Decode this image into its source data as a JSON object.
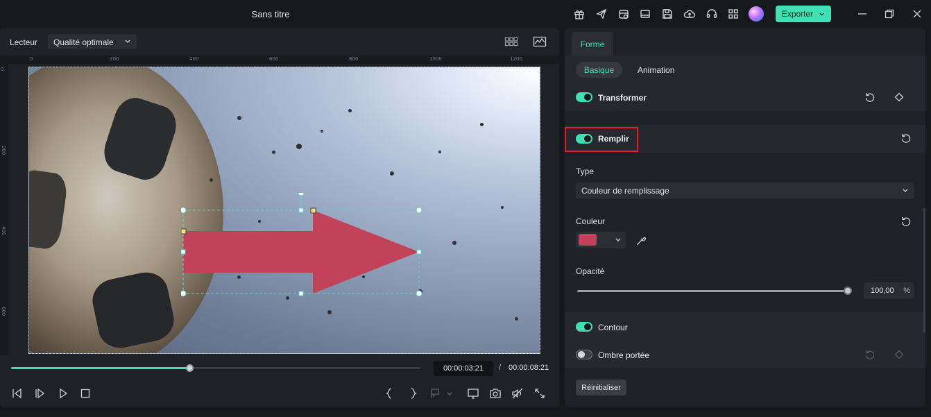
{
  "app": {
    "title": "Sans titre",
    "export_label": "Exporter",
    "accent_color": "#40e0b5"
  },
  "titlebar_icons": [
    "gift-icon",
    "send-icon",
    "calendar-icon",
    "layout-icon",
    "save-icon",
    "cloud-upload-icon",
    "headset-icon",
    "grid-icon"
  ],
  "player": {
    "label": "Lecteur",
    "quality": "Qualité optimale",
    "ruler_top": [
      "0",
      "200",
      "400",
      "600",
      "800",
      "1000",
      "1200"
    ],
    "ruler_left": [
      "0",
      "200",
      "400",
      "600"
    ],
    "current_time": "00:00:03:21",
    "separator": "/",
    "total_time": "00:00:08:21",
    "progress": 0.436
  },
  "shape": {
    "fill_color": "#c2425a"
  },
  "panel": {
    "tab": "Forme",
    "subtabs": {
      "basic": "Basique",
      "animation": "Animation"
    },
    "transform": {
      "label": "Transformer",
      "enabled": true
    },
    "fill": {
      "label": "Remplir",
      "enabled": true,
      "type_label": "Type",
      "type_value": "Couleur de remplissage",
      "color_label": "Couleur",
      "color_value": "#c2425a",
      "opacity_label": "Opacité",
      "opacity_value": "100,00",
      "opacity_unit": "%",
      "opacity_fraction": 1.0
    },
    "outline": {
      "label": "Contour",
      "enabled": true
    },
    "shadow": {
      "label": "Ombre portée",
      "enabled": false
    },
    "reset_label": "Réinitialiser"
  }
}
